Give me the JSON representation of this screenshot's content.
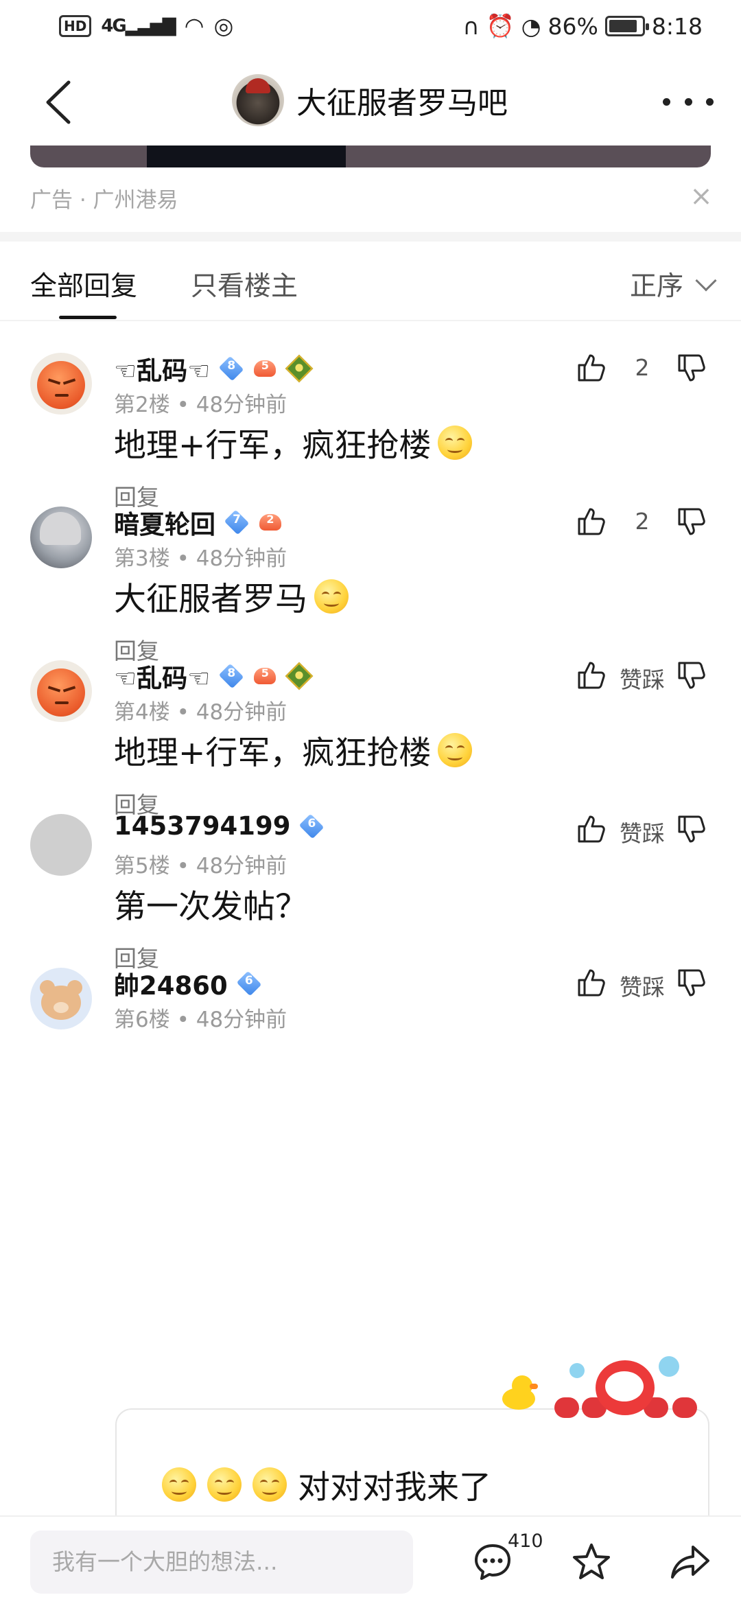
{
  "status_bar": {
    "hd": "HD",
    "network": "4G",
    "battery": "86%",
    "battery_level": 0.86,
    "time": "8:18"
  },
  "nav": {
    "title": "大征服者罗马吧"
  },
  "ad": {
    "label": "广告 · 广州港易"
  },
  "tabs": {
    "all": "全部回复",
    "owner": "只看楼主",
    "sort": "正序"
  },
  "posts": [
    {
      "user": "☜乱码☜",
      "level": "8",
      "game_badge": "5",
      "floor": "第2楼",
      "time": "48分钟前",
      "text": "地理+行军，疯狂抢楼",
      "likes": "2",
      "reply": "回复"
    },
    {
      "user": "暗夏轮回",
      "level": "7",
      "game_badge": "2",
      "floor": "第3楼",
      "time": "48分钟前",
      "text": "大征服者罗马",
      "likes": "2",
      "reply": "回复"
    },
    {
      "user": "☜乱码☜",
      "level": "8",
      "game_badge": "5",
      "floor": "第4楼",
      "time": "48分钟前",
      "text": "地理+行军，疯狂抢楼",
      "likes": "赞踩",
      "reply": "回复"
    },
    {
      "user": "1453794199",
      "level": "6",
      "floor": "第5楼",
      "time": "48分钟前",
      "text": "第一次发帖？",
      "likes": "赞踩",
      "reply": "回复"
    },
    {
      "user": "帥24860",
      "level": "6",
      "floor": "第6楼",
      "time": "48分钟前",
      "likes": "赞踩"
    }
  ],
  "card": {
    "text": "对对对我来了"
  },
  "bottom": {
    "placeholder": "我有一个大胆的想法...",
    "comment_count": "410"
  },
  "colors": {
    "level_badge": "#3d86ea",
    "text": "#141414",
    "muted": "#9a9a9a"
  }
}
